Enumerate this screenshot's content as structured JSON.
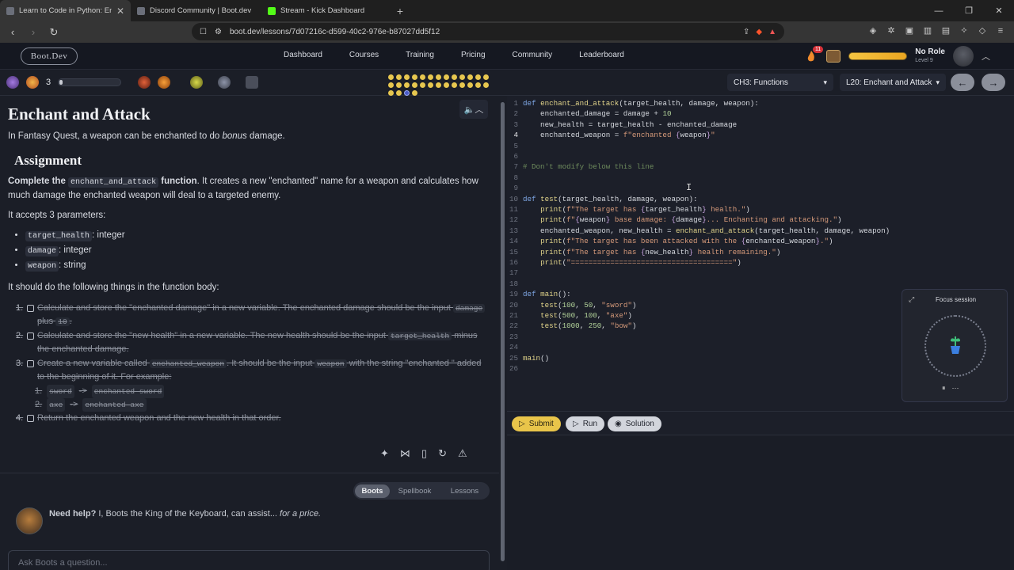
{
  "browser": {
    "tabs": [
      {
        "label": "Learn to Code in Python: Enchant"
      },
      {
        "label": "Discord Community | Boot.dev"
      },
      {
        "label": "Stream - Kick Dashboard"
      }
    ],
    "url": "boot.dev/lessons/7d07216c-d599-40c2-976e-b87027dd5f12"
  },
  "site": {
    "logo": "Boot.Dev",
    "nav": [
      "Dashboard",
      "Courses",
      "Training",
      "Pricing",
      "Community",
      "Leaderboard"
    ],
    "streak_badge": "11",
    "role": "No Role",
    "level": "Level 9"
  },
  "lessonbar": {
    "gem_count": "3",
    "xp_progress": 0.05,
    "chapter": "CH3: Functions",
    "lesson": "L20: Enchant and Attack"
  },
  "lesson": {
    "title": "Enchant and Attack",
    "intro_pre": "In Fantasy Quest, a weapon can be enchanted to do ",
    "intro_em": "bonus",
    "intro_post": " damage.",
    "h2": "Assignment",
    "task_b1": "Complete the ",
    "task_code": "enchant_and_attack",
    "task_b2": " function",
    "task_rest": ". It creates a new \"enchanted\" name for a weapon and calculates how much damage the enchanted weapon will deal to a targeted enemy.",
    "params_intro": "It accepts 3 parameters:",
    "params": [
      {
        "name": "target_health",
        "type": ": integer"
      },
      {
        "name": "damage",
        "type": ": integer"
      },
      {
        "name": "weapon",
        "type": ": string"
      }
    ],
    "body_intro": "It should do the following things in the function body:",
    "step1a": "Calculate and store the \"enchanted damage\" in a new variable. The enchanted damage should be the input ",
    "step1b": "damage",
    "step1c": "plus ",
    "step1d": "10",
    "step2a": "Calculate and store the \"new health\" in a new variable. The new health should be the input ",
    "step2b": "target_health",
    "step2c": " minus",
    "step2d": "the enchanted damage.",
    "step3a": "Create a new variable called ",
    "step3b": "enchanted_weapon",
    "step3c": ". It should be the input ",
    "step3d": "weapon",
    "step3e": " with the string \"enchanted \" added",
    "step3f": "to the beginning of it. For example:",
    "ex1a": "sword",
    "ex1b": "enchanted sword",
    "ex2a": "axe",
    "ex2b": "enchanted axe",
    "step4": "Return the enchanted weapon and the new health in that order.",
    "help_tabs": [
      "Boots",
      "Spellbook",
      "Lessons"
    ],
    "help_bold": "Need help?",
    "help_text": " I, Boots the King of the Keyboard, can assist... ",
    "help_em": "for a price.",
    "ask_placeholder": "Ask Boots a question..."
  },
  "editor": {
    "current_line": 4,
    "lines": [
      "def enchant_and_attack(target_health, damage, weapon):",
      "    enchanted_damage = damage + 10",
      "    new_health = target_health - enchanted_damage",
      "    enchanted_weapon = f\"enchanted {weapon}\"",
      "",
      "",
      "# Don't modify below this line",
      "",
      "",
      "def test(target_health, damage, weapon):",
      "    print(f\"The target has {target_health} health.\")",
      "    print(f\"{weapon} base damage: {damage}... Enchanting and attacking.\")",
      "    enchanted_weapon, new_health = enchant_and_attack(target_health, damage, weapon)",
      "    print(f\"The target has been attacked with the {enchanted_weapon}.\")",
      "    print(f\"The target has {new_health} health remaining.\")",
      "    print(\"=====================================\")",
      "",
      "",
      "def main():",
      "    test(100, 50, \"sword\")",
      "    test(500, 100, \"axe\")",
      "    test(1000, 250, \"bow\")",
      "",
      "",
      "main()",
      ""
    ],
    "buttons": {
      "submit": "Submit",
      "run": "Run",
      "solution": "Solution"
    }
  },
  "focus": {
    "title": "Focus session"
  }
}
